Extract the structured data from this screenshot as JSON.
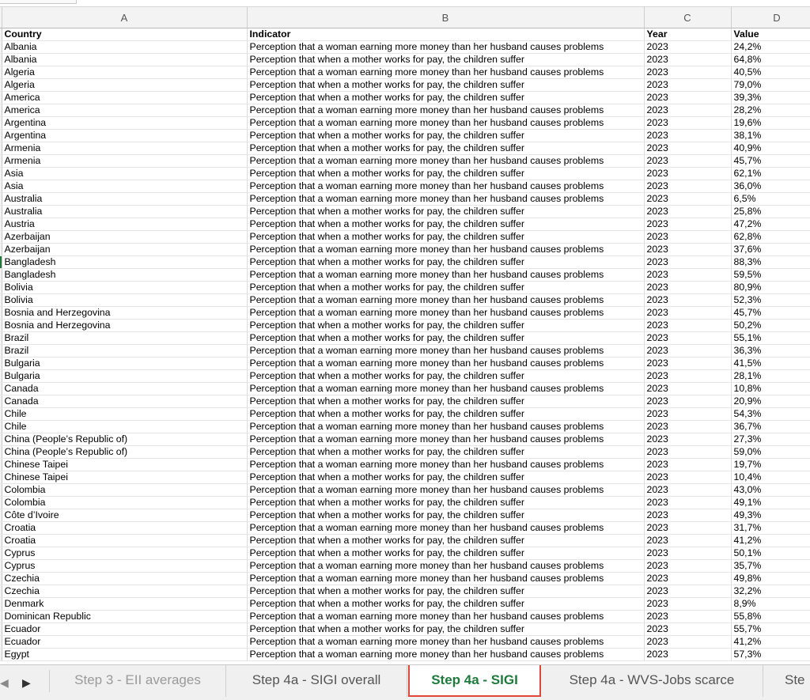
{
  "columns": [
    "A",
    "B",
    "C",
    "D"
  ],
  "header_row": {
    "country": "Country",
    "indicator": "Indicator",
    "year": "Year",
    "value": "Value"
  },
  "rows": [
    [
      "Albania",
      "Perception that a woman earning more money than her husband causes problems",
      "2023",
      "24,2%"
    ],
    [
      "Albania",
      "Perception that when a mother works for pay, the children suffer",
      "2023",
      "64,8%"
    ],
    [
      "Algeria",
      "Perception that a woman earning more money than her husband causes problems",
      "2023",
      "40,5%"
    ],
    [
      "Algeria",
      "Perception that when a mother works for pay, the children suffer",
      "2023",
      "79,0%"
    ],
    [
      "America",
      "Perception that when a mother works for pay, the children suffer",
      "2023",
      "39,3%"
    ],
    [
      "America",
      "Perception that a woman earning more money than her husband causes problems",
      "2023",
      "28,2%"
    ],
    [
      "Argentina",
      "Perception that a woman earning more money than her husband causes problems",
      "2023",
      "19,6%"
    ],
    [
      "Argentina",
      "Perception that when a mother works for pay, the children suffer",
      "2023",
      "38,1%"
    ],
    [
      "Armenia",
      "Perception that when a mother works for pay, the children suffer",
      "2023",
      "40,9%"
    ],
    [
      "Armenia",
      "Perception that a woman earning more money than her husband causes problems",
      "2023",
      "45,7%"
    ],
    [
      "Asia",
      "Perception that when a mother works for pay, the children suffer",
      "2023",
      "62,1%"
    ],
    [
      "Asia",
      "Perception that a woman earning more money than her husband causes problems",
      "2023",
      "36,0%"
    ],
    [
      "Australia",
      "Perception that a woman earning more money than her husband causes problems",
      "2023",
      "6,5%"
    ],
    [
      "Australia",
      "Perception that when a mother works for pay, the children suffer",
      "2023",
      "25,8%"
    ],
    [
      "Austria",
      "Perception that when a mother works for pay, the children suffer",
      "2023",
      "47,2%"
    ],
    [
      "Azerbaijan",
      "Perception that when a mother works for pay, the children suffer",
      "2023",
      "62,8%"
    ],
    [
      "Azerbaijan",
      "Perception that a woman earning more money than her husband causes problems",
      "2023",
      "37,6%"
    ],
    [
      "Bangladesh",
      "Perception that when a mother works for pay, the children suffer",
      "2023",
      "88,3%"
    ],
    [
      "Bangladesh",
      "Perception that a woman earning more money than her husband causes problems",
      "2023",
      "59,5%"
    ],
    [
      "Bolivia",
      "Perception that when a mother works for pay, the children suffer",
      "2023",
      "80,9%"
    ],
    [
      "Bolivia",
      "Perception that a woman earning more money than her husband causes problems",
      "2023",
      "52,3%"
    ],
    [
      "Bosnia and Herzegovina",
      "Perception that a woman earning more money than her husband causes problems",
      "2023",
      "45,7%"
    ],
    [
      "Bosnia and Herzegovina",
      "Perception that when a mother works for pay, the children suffer",
      "2023",
      "50,2%"
    ],
    [
      "Brazil",
      "Perception that when a mother works for pay, the children suffer",
      "2023",
      "55,1%"
    ],
    [
      "Brazil",
      "Perception that a woman earning more money than her husband causes problems",
      "2023",
      "36,3%"
    ],
    [
      "Bulgaria",
      "Perception that a woman earning more money than her husband causes problems",
      "2023",
      "41,5%"
    ],
    [
      "Bulgaria",
      "Perception that when a mother works for pay, the children suffer",
      "2023",
      "28,1%"
    ],
    [
      "Canada",
      "Perception that a woman earning more money than her husband causes problems",
      "2023",
      "10,8%"
    ],
    [
      "Canada",
      "Perception that when a mother works for pay, the children suffer",
      "2023",
      "20,9%"
    ],
    [
      "Chile",
      "Perception that when a mother works for pay, the children suffer",
      "2023",
      "54,3%"
    ],
    [
      "Chile",
      "Perception that a woman earning more money than her husband causes problems",
      "2023",
      "36,7%"
    ],
    [
      "China (People’s Republic of)",
      "Perception that a woman earning more money than her husband causes problems",
      "2023",
      "27,3%"
    ],
    [
      "China (People’s Republic of)",
      "Perception that when a mother works for pay, the children suffer",
      "2023",
      "59,0%"
    ],
    [
      "Chinese Taipei",
      "Perception that a woman earning more money than her husband causes problems",
      "2023",
      "19,7%"
    ],
    [
      "Chinese Taipei",
      "Perception that when a mother works for pay, the children suffer",
      "2023",
      "10,4%"
    ],
    [
      "Colombia",
      "Perception that a woman earning more money than her husband causes problems",
      "2023",
      "43,0%"
    ],
    [
      "Colombia",
      "Perception that when a mother works for pay, the children suffer",
      "2023",
      "49,1%"
    ],
    [
      "Côte d’Ivoire",
      "Perception that when a mother works for pay, the children suffer",
      "2023",
      "49,3%"
    ],
    [
      "Croatia",
      "Perception that a woman earning more money than her husband causes problems",
      "2023",
      "31,7%"
    ],
    [
      "Croatia",
      "Perception that when a mother works for pay, the children suffer",
      "2023",
      "41,2%"
    ],
    [
      "Cyprus",
      "Perception that when a mother works for pay, the children suffer",
      "2023",
      "50,1%"
    ],
    [
      "Cyprus",
      "Perception that a woman earning more money than her husband causes problems",
      "2023",
      "35,7%"
    ],
    [
      "Czechia",
      "Perception that a woman earning more money than her husband causes problems",
      "2023",
      "49,8%"
    ],
    [
      "Czechia",
      "Perception that when a mother works for pay, the children suffer",
      "2023",
      "32,2%"
    ],
    [
      "Denmark",
      "Perception that when a mother works for pay, the children suffer",
      "2023",
      "8,9%"
    ],
    [
      "Dominican Republic",
      "Perception that a woman earning more money than her husband causes problems",
      "2023",
      "55,8%"
    ],
    [
      "Ecuador",
      "Perception that when a mother works for pay, the children suffer",
      "2023",
      "55,7%"
    ],
    [
      "Ecuador",
      "Perception that a woman earning more money than her husband causes problems",
      "2023",
      "41,2%"
    ],
    [
      "Egypt",
      "Perception that a woman earning more money than her husband causes problems",
      "2023",
      "57,3%"
    ]
  ],
  "marked_row": 17,
  "sheet_tabs": [
    {
      "label": "Step 3 - EII averages",
      "active": false
    },
    {
      "label": "Step 4a - SIGI overall",
      "active": false
    },
    {
      "label": "Step 4a - SIGI",
      "active": true
    },
    {
      "label": "Step 4a - WVS-Jobs scarce",
      "active": false
    },
    {
      "label": "Ste",
      "active": false
    }
  ],
  "nav": {
    "prev_icon": "triangle-left-icon",
    "next_icon": "triangle-right-icon"
  },
  "colors": {
    "active_tab_text": "#1e7b3c",
    "active_tab_border": "#e0463a",
    "row_marker": "#1f7a3a"
  }
}
